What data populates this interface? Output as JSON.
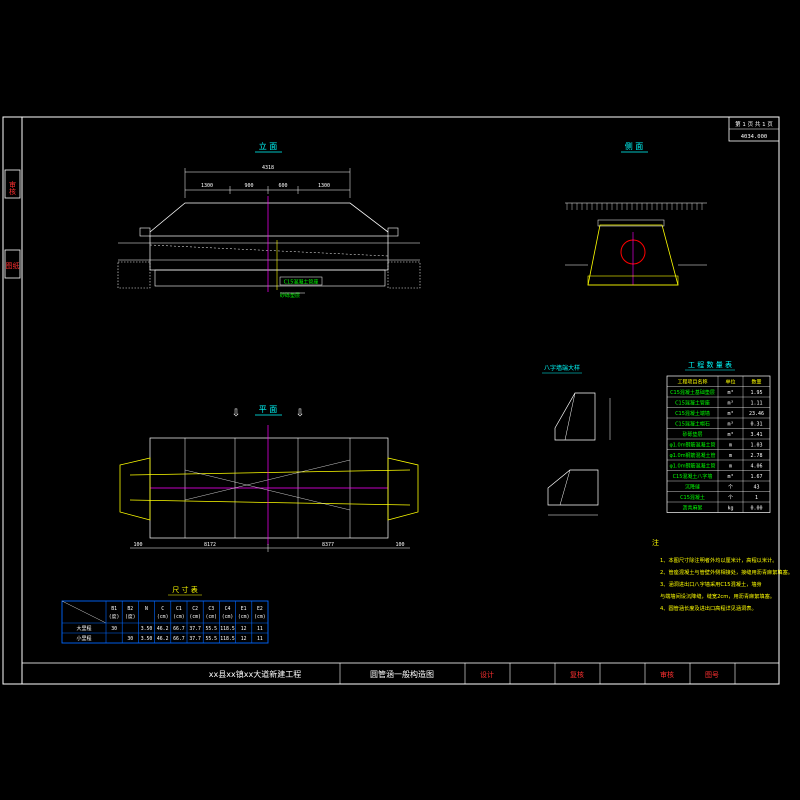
{
  "side_tabs": [
    "审核",
    "图纸"
  ],
  "sheet": {
    "page": "第 1 页  共 1 页",
    "drawing_no": "4034.000"
  },
  "views": {
    "elevation": "立 面",
    "side": "侧 面",
    "plan": "平 面",
    "wingwall": "八字墙端大样",
    "dims_table_title": "尺 寸 表",
    "quantities_title": "工 程 数 量 表"
  },
  "elevation_dims": [
    "1300",
    "900",
    "600",
    "1300",
    "4318"
  ],
  "elevation_labels": [
    "C15混凝土管座",
    "砂砾垫层"
  ],
  "plan_dims": [
    "8172",
    "8377",
    "100",
    "100"
  ],
  "dims_table": {
    "headers": [
      "B1\n(度)",
      "B2\n(度)",
      "N",
      "C\n(cm)",
      "C1\n(cm)",
      "C2\n(cm)",
      "C3\n(cm)",
      "C4\n(cm)",
      "E1\n(cm)",
      "E2\n(cm)"
    ],
    "rows": [
      {
        "name": "大里程",
        "values": [
          "30",
          "",
          "3.50",
          "46.2",
          "66.7",
          "37.7",
          "55.5",
          "118.5",
          "12",
          "11"
        ]
      },
      {
        "name": "小里程",
        "values": [
          "",
          "30",
          "3.50",
          "46.2",
          "66.7",
          "37.7",
          "55.5",
          "118.5",
          "12",
          "11"
        ]
      }
    ]
  },
  "quantities": {
    "headers": [
      "工程项目名称",
      "单位",
      "数量"
    ],
    "rows": [
      [
        "C15混凝土基础垫层",
        "m³",
        "1.95"
      ],
      [
        "C15混凝土管座",
        "m³",
        "1.11"
      ],
      [
        "C15混凝土端墙",
        "m³",
        "23.46"
      ],
      [
        "C15混凝土帽石",
        "m³",
        "0.31"
      ],
      [
        "砂砾垫层",
        "m³",
        "3.41"
      ],
      [
        "φ1.0m钢筋混凝土管",
        "m",
        "1.03"
      ],
      [
        "φ1.0m钢筋混凝土管",
        "m",
        "2.78"
      ],
      [
        "φ1.0m钢筋混凝土管",
        "m",
        "4.06"
      ],
      [
        "C15混凝土八字墙",
        "m³",
        "1.67"
      ],
      [
        "沉降缝",
        "个",
        "43"
      ],
      [
        "C15混凝土",
        "个",
        "1"
      ],
      [
        "沥青麻絮",
        "kg",
        "0.00"
      ]
    ]
  },
  "notes": {
    "title": "注",
    "items": [
      "1、本图尺寸除注明者外均以厘米计，高程以米计。",
      "2、管座混凝土与管壁外侧相接处，接缝用沥青麻絮填塞。",
      "3、涵洞进出口八字墙采用C15混凝土，墙身",
      "   与端墙间设沉降缝，缝宽2cm，用沥青麻絮填塞。",
      "4、圆管涵长度及进出口高程详见涵洞表。"
    ]
  },
  "title_block": {
    "project": "xx县xx镇xx大道新建工程",
    "drawing": "圆管涵一般构造图",
    "design": "设计",
    "review": "复核",
    "approve": "审核",
    "number": "图号"
  }
}
